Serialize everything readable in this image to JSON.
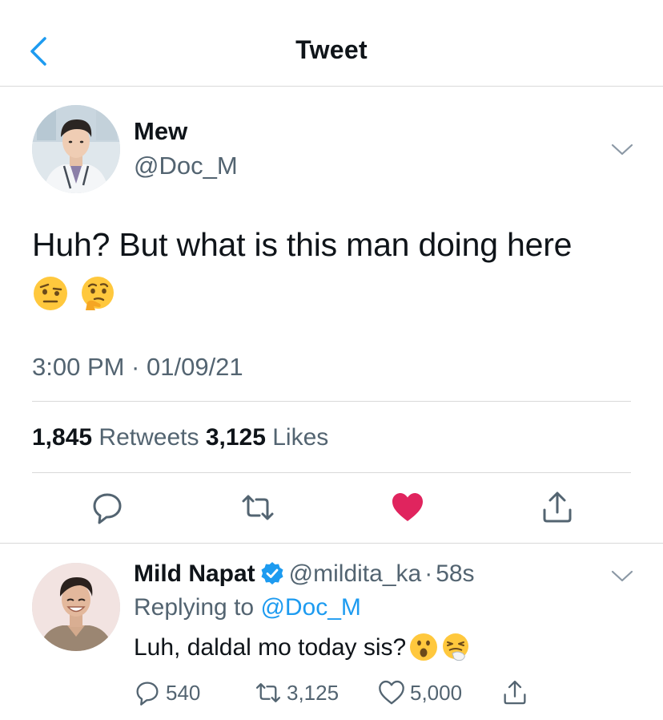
{
  "header": {
    "title": "Tweet",
    "back_icon": "chevron-left-icon"
  },
  "main_tweet": {
    "author_name": "Mew",
    "handle": "@Doc_M",
    "text": "Huh? But what is this man doing here",
    "emojis": [
      "face-with-raised-eyebrow",
      "thinking-face"
    ],
    "timestamp": "3:00 PM · 01/09/21",
    "retweets_count": "1,845",
    "retweets_label": "Retweets",
    "likes_count": "3,125",
    "likes_label": "Likes",
    "liked": true,
    "actions": [
      "reply-icon",
      "retweet-icon",
      "heart-icon",
      "share-icon"
    ]
  },
  "reply_tweet": {
    "author_name": "Mild Napat",
    "verified": true,
    "handle": "@mildita_ka",
    "separator": "·",
    "time": "58s",
    "replying_to_label": "Replying to",
    "replying_to_handle": "@Doc_M",
    "text": "Luh, daldal mo today sis?",
    "emojis": [
      "face-with-open-mouth",
      "sneezing-face"
    ],
    "reply_count": "540",
    "retweet_count": "3,125",
    "like_count": "5,000"
  },
  "colors": {
    "accent_blue": "#1d9bf0",
    "like_red": "#e0245e",
    "secondary_text": "#536471",
    "primary_text": "#0f1419",
    "divider": "#d9d9d9"
  }
}
